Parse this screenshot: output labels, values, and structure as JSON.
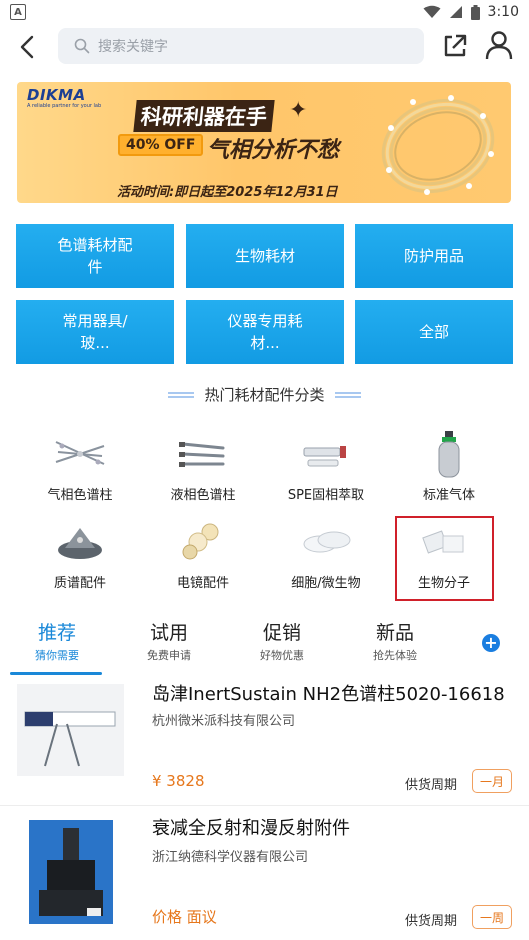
{
  "status_bar": {
    "time": "3:10",
    "app_badge": "A"
  },
  "header": {
    "search_placeholder": "搜索关键字"
  },
  "banner": {
    "logo": "DIKMA",
    "logo_sub": "A reliable partner for your lab",
    "title1": "科研利器在手",
    "discount": "40% OFF",
    "title2": "气相分析不愁",
    "date": "活动时间:即日起至2025年12月31日"
  },
  "categories": [
    {
      "label": "色谱耗材配件"
    },
    {
      "label": "生物耗材"
    },
    {
      "label": "防护用品"
    },
    {
      "label": "常用器具/玻..."
    },
    {
      "label": "仪器专用耗材..."
    },
    {
      "label": "全部"
    }
  ],
  "section_title": "热门耗材配件分类",
  "product_categories": [
    {
      "label": "气相色谱柱",
      "icon": "gc-column-icon"
    },
    {
      "label": "液相色谱柱",
      "icon": "lc-column-icon"
    },
    {
      "label": "SPE固相萃取",
      "icon": "spe-icon"
    },
    {
      "label": "标准气体",
      "icon": "gas-cylinder-icon"
    },
    {
      "label": "质谱配件",
      "icon": "ms-part-icon"
    },
    {
      "label": "电镜配件",
      "icon": "em-part-icon"
    },
    {
      "label": "细胞/微生物",
      "icon": "petri-dish-icon"
    },
    {
      "label": "生物分子",
      "icon": "biomolecule-icon"
    }
  ],
  "tabs": [
    {
      "title": "推荐",
      "sub": "猜你需要"
    },
    {
      "title": "试用",
      "sub": "免费申请"
    },
    {
      "title": "促销",
      "sub": "好物优惠"
    },
    {
      "title": "新品",
      "sub": "抢先体验"
    }
  ],
  "products": [
    {
      "title": "岛津InertSustain NH2色谱柱5020-16618",
      "company": "杭州微米派科技有限公司",
      "price": "¥ 3828",
      "supply_label": "供货周期",
      "cycle": "一月"
    },
    {
      "title": "衰减全反射和漫反射附件",
      "company": "浙江纳德科学仪器有限公司",
      "price": "价格 面议",
      "supply_label": "供货周期",
      "cycle": "一周"
    }
  ],
  "colors": {
    "accent": "#1a88d8",
    "tile": "#1ba6ea",
    "price": "#e6771c",
    "highlight": "#d0202a"
  }
}
